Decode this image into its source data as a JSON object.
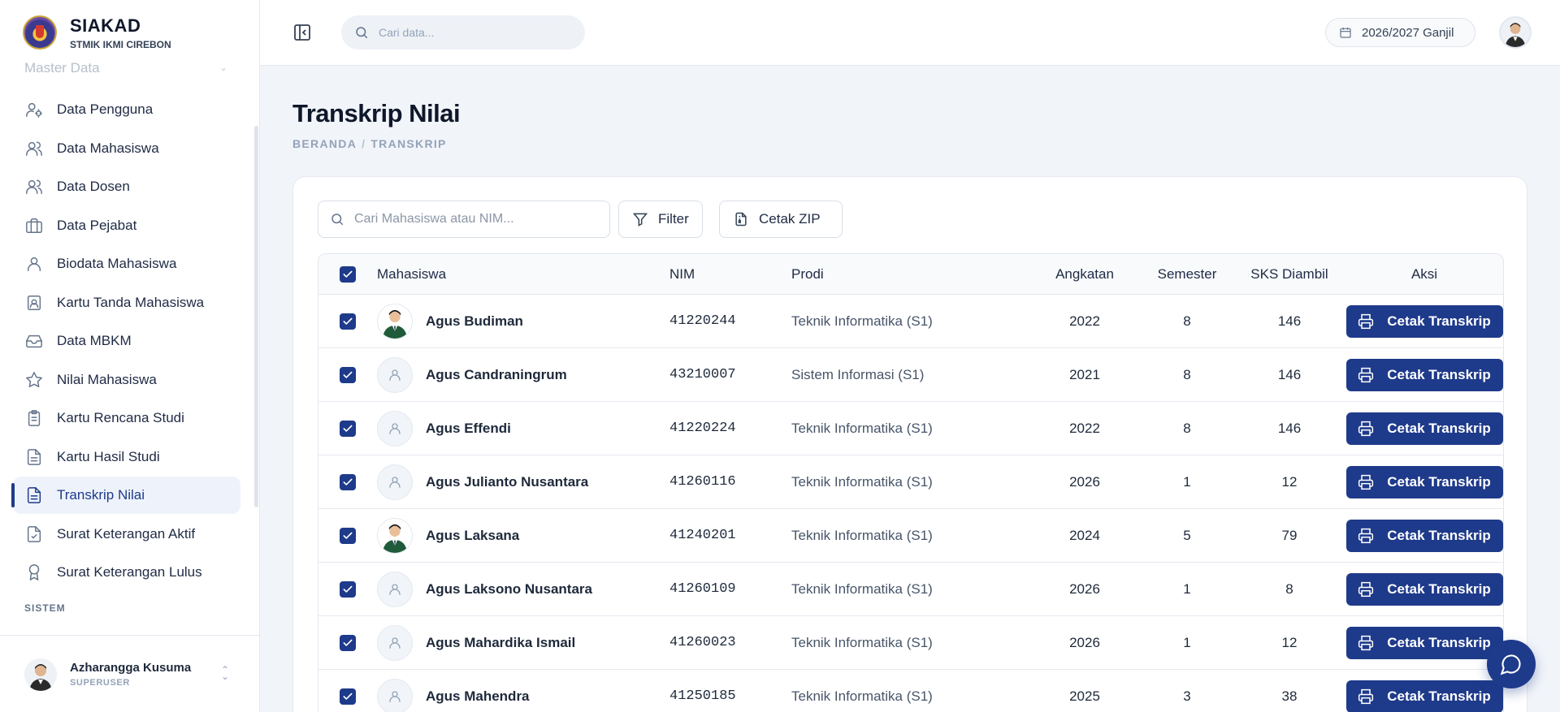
{
  "brand": {
    "title": "SIAKAD",
    "subtitle": "STMIK IKMI CIREBON"
  },
  "sidebar": {
    "faded_item": "Master Data",
    "items": [
      {
        "label": "Data Pengguna",
        "icon": "users-cog-icon",
        "active": false
      },
      {
        "label": "Data Mahasiswa",
        "icon": "users-icon",
        "active": false
      },
      {
        "label": "Data Dosen",
        "icon": "users-icon",
        "active": false
      },
      {
        "label": "Data Pejabat",
        "icon": "briefcase-icon",
        "active": false
      },
      {
        "label": "Biodata Mahasiswa",
        "icon": "user-icon",
        "active": false
      },
      {
        "label": "Kartu Tanda Mahasiswa",
        "icon": "id-card-icon",
        "active": false
      },
      {
        "label": "Data MBKM",
        "icon": "inbox-icon",
        "active": false
      },
      {
        "label": "Nilai Mahasiswa",
        "icon": "star-icon",
        "active": false
      },
      {
        "label": "Kartu Rencana Studi",
        "icon": "clipboard-icon",
        "active": false
      },
      {
        "label": "Kartu Hasil Studi",
        "icon": "file-text-icon",
        "active": false
      },
      {
        "label": "Transkrip Nilai",
        "icon": "file-text-icon",
        "active": true
      },
      {
        "label": "Surat Keterangan Aktif",
        "icon": "file-check-icon",
        "active": false
      },
      {
        "label": "Surat Keterangan Lulus",
        "icon": "award-icon",
        "active": false
      }
    ],
    "section_label": "SISTEM",
    "user": {
      "name": "Azharangga Kusuma",
      "role": "SUPERUSER"
    }
  },
  "topbar": {
    "search_placeholder": "Cari data...",
    "period": "2026/2027 Ganjil"
  },
  "page": {
    "title": "Transkrip Nilai",
    "breadcrumb": [
      "BERANDA",
      "TRANSKRIP"
    ]
  },
  "toolbar": {
    "search_placeholder": "Cari Mahasiswa atau NIM...",
    "filter_label": "Filter",
    "zip_label": "Cetak ZIP"
  },
  "table": {
    "headers": {
      "mahasiswa": "Mahasiswa",
      "nim": "NIM",
      "prodi": "Prodi",
      "angkatan": "Angkatan",
      "semester": "Semester",
      "sks": "SKS Diambil",
      "aksi": "Aksi"
    },
    "action_label": "Cetak Transkrip",
    "rows": [
      {
        "name": "Agus Budiman",
        "nim": "41220244",
        "prodi": "Teknik Informatika (S1)",
        "angkatan": "2022",
        "semester": "8",
        "sks": "146",
        "photo": true
      },
      {
        "name": "Agus Candraningrum",
        "nim": "43210007",
        "prodi": "Sistem Informasi (S1)",
        "angkatan": "2021",
        "semester": "8",
        "sks": "146",
        "photo": false
      },
      {
        "name": "Agus Effendi",
        "nim": "41220224",
        "prodi": "Teknik Informatika (S1)",
        "angkatan": "2022",
        "semester": "8",
        "sks": "146",
        "photo": false
      },
      {
        "name": "Agus Julianto Nusantara",
        "nim": "41260116",
        "prodi": "Teknik Informatika (S1)",
        "angkatan": "2026",
        "semester": "1",
        "sks": "12",
        "photo": false
      },
      {
        "name": "Agus Laksana",
        "nim": "41240201",
        "prodi": "Teknik Informatika (S1)",
        "angkatan": "2024",
        "semester": "5",
        "sks": "79",
        "photo": true
      },
      {
        "name": "Agus Laksono Nusantara",
        "nim": "41260109",
        "prodi": "Teknik Informatika (S1)",
        "angkatan": "2026",
        "semester": "1",
        "sks": "8",
        "photo": false
      },
      {
        "name": "Agus Mahardika Ismail",
        "nim": "41260023",
        "prodi": "Teknik Informatika (S1)",
        "angkatan": "2026",
        "semester": "1",
        "sks": "12",
        "photo": false
      },
      {
        "name": "Agus Mahendra",
        "nim": "41250185",
        "prodi": "Teknik Informatika (S1)",
        "angkatan": "2025",
        "semester": "3",
        "sks": "38",
        "photo": false
      }
    ]
  },
  "colors": {
    "primary": "#1e3a8a",
    "background": "#f1f4f9"
  }
}
